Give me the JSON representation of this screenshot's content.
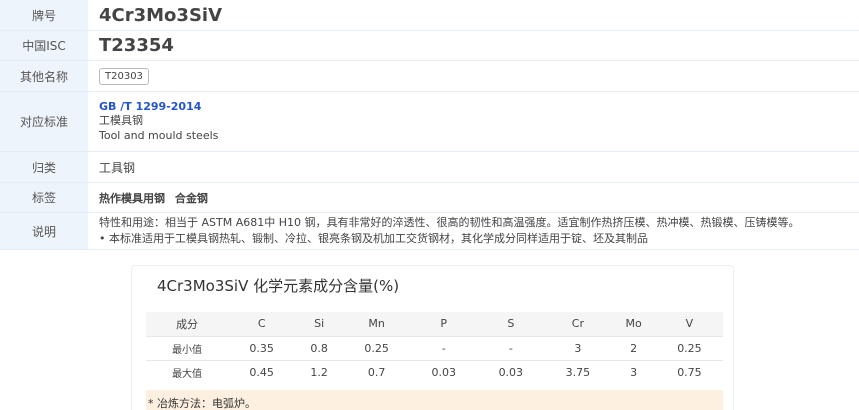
{
  "info": {
    "brand_label": "牌号",
    "brand_value": "4Cr3Mo3SiV",
    "isc_label": "中国ISC",
    "isc_value": "T23354",
    "alias_label": "其他名称",
    "alias_value": "T20303",
    "std_label": "对应标准",
    "std_code": "GB /T 1299-2014",
    "std_name_cn": "工模具钢",
    "std_name_en": "Tool and mould steels",
    "category_label": "归类",
    "category_value": "工具钢",
    "tags_label": "标签",
    "tags": [
      "热作模具用钢",
      "合金钢"
    ],
    "desc_label": "说明",
    "desc_line1": "特性和用途：相当于 ASTM A681中 H10 钢，具有非常好的淬透性、很高的韧性和高温强度。适宜制作热挤压模、热冲模、热锻模、压铸模等。",
    "desc_line2": "• 本标准适用于工模具钢热轧、锻制、冷拉、银亮条钢及机加工交货钢材，其化学成分同样适用于锭、坯及其制品"
  },
  "chem": {
    "title": "4Cr3Mo3SiV 化学元素成分含量(%)",
    "headers": [
      "成分",
      "C",
      "Si",
      "Mn",
      "P",
      "S",
      "Cr",
      "Mo",
      "V"
    ],
    "rows": [
      [
        "最小值",
        "0.35",
        "0.8",
        "0.25",
        "-",
        "-",
        "3",
        "2",
        "0.25"
      ],
      [
        "最大值",
        "0.45",
        "1.2",
        "0.7",
        "0.03",
        "0.03",
        "3.75",
        "3",
        "0.75"
      ]
    ],
    "note": "* 冶炼方法：电弧炉。"
  }
}
